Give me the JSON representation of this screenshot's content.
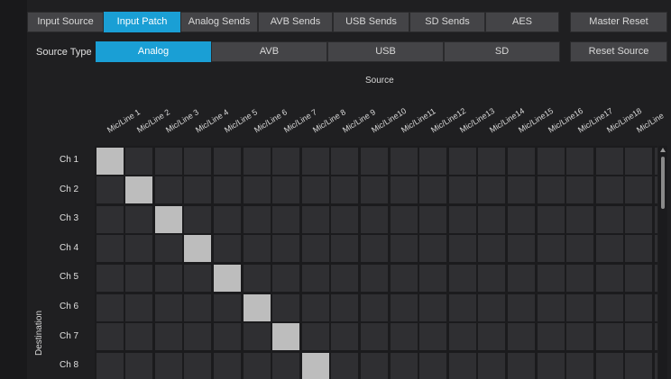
{
  "top_tabs": [
    "Input Source",
    "Input Patch",
    "Analog Sends",
    "AVB Sends",
    "USB Sends",
    "SD Sends",
    "AES"
  ],
  "active_tab": "Input Patch",
  "master_reset": "Master Reset",
  "source_type": {
    "label": "Source Type",
    "options": [
      "Analog",
      "AVB",
      "USB",
      "SD"
    ],
    "selected": "Analog"
  },
  "reset_source": "Reset Source",
  "source_axis": "Source",
  "destination_axis": "Destination",
  "columns": [
    "Mic/Line 1",
    "Mic/Line 2",
    "Mic/Line 3",
    "Mic/Line 4",
    "Mic/Line 5",
    "Mic/Line 6",
    "Mic/Line 7",
    "Mic/Line 8",
    "Mic/Line 9",
    "Mic/Line10",
    "Mic/Line11",
    "Mic/Line12",
    "Mic/Line13",
    "Mic/Line14",
    "Mic/Line15",
    "Mic/Line16",
    "Mic/Line17",
    "Mic/Line18",
    "Mic/Line"
  ],
  "rows": [
    "Ch 1",
    "Ch 2",
    "Ch 3",
    "Ch 4",
    "Ch 5",
    "Ch 6",
    "Ch 7",
    "Ch 8"
  ],
  "patched": [
    [
      0,
      0
    ],
    [
      1,
      1
    ],
    [
      2,
      2
    ],
    [
      3,
      3
    ],
    [
      4,
      4
    ],
    [
      5,
      5
    ],
    [
      6,
      6
    ],
    [
      7,
      7
    ]
  ],
  "colors": {
    "accent": "#1a9fd5",
    "cell": "#2f2f32",
    "cell_on": "#bdbdbd"
  }
}
